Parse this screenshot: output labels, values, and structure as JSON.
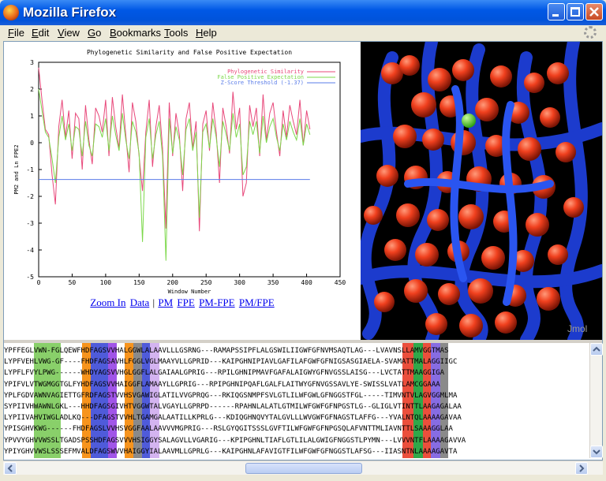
{
  "window": {
    "title": "Mozilla Firefox",
    "icon": "firefox-icon"
  },
  "menu": [
    {
      "label": "File",
      "accel": "F"
    },
    {
      "label": "Edit",
      "accel": "E"
    },
    {
      "label": "View",
      "accel": "V"
    },
    {
      "label": "Go",
      "accel": "G"
    },
    {
      "label": "Bookmarks",
      "accel": "B"
    },
    {
      "label": "Tools",
      "accel": "T"
    },
    {
      "label": "Help",
      "accel": "H"
    }
  ],
  "chart_data": {
    "type": "line",
    "title": "Phylogenetic Similarity and False Positive Expectation",
    "xlabel": "Window Number",
    "ylabel": "PM2 and Ln FPE2",
    "xlim": [
      0,
      450
    ],
    "ylim": [
      -5,
      3
    ],
    "xticks": [
      0,
      50,
      100,
      150,
      200,
      250,
      300,
      350,
      400,
      450
    ],
    "yticks": [
      3,
      2,
      1,
      0,
      -1,
      -2,
      -3,
      -4,
      -5
    ],
    "legend_position": "top-right",
    "series": [
      {
        "name": "Phylogenetic Similarity",
        "color": "#E8487A",
        "x": [
          0,
          5,
          10,
          15,
          20,
          25,
          30,
          35,
          40,
          45,
          50,
          55,
          60,
          65,
          70,
          75,
          80,
          85,
          90,
          95,
          100,
          105,
          110,
          115,
          120,
          125,
          130,
          135,
          140,
          145,
          150,
          155,
          160,
          165,
          170,
          175,
          180,
          185,
          190,
          195,
          200,
          205,
          210,
          215,
          220,
          225,
          230,
          235,
          240,
          245,
          250,
          255,
          260,
          265,
          270,
          275,
          280,
          285,
          290,
          295,
          300,
          305,
          310,
          315,
          320,
          325,
          330,
          335,
          340,
          345,
          350,
          355,
          360,
          365,
          370,
          375,
          380,
          385,
          390,
          395,
          400,
          405
        ],
        "y": [
          2.8,
          1.6,
          0.5,
          0.3,
          -1.2,
          -2.3,
          0.6,
          1.6,
          0.2,
          1.2,
          -0.6,
          1.1,
          0.9,
          -1.0,
          1.4,
          0.1,
          -0.8,
          1.3,
          1.0,
          0.4,
          1.6,
          -0.5,
          1.7,
          0.6,
          -0.2,
          1.8,
          0.3,
          -1.1,
          1.5,
          0.8,
          -0.5,
          -1.8,
          0.4,
          1.6,
          -0.9,
          0.6,
          1.4,
          -0.2,
          -3.2,
          1.5,
          -0.5,
          1.1,
          0.3,
          -1.8,
          0.9,
          1.5,
          -0.2,
          0.8,
          -3.3,
          0.7,
          1.2,
          -0.3,
          1.5,
          0.4,
          -1.5,
          1.3,
          0.6,
          -0.4,
          1.9,
          0.5,
          1.3,
          -2.0,
          -1.5,
          1.4,
          0.6,
          1.3,
          -0.5,
          1.8,
          0.1,
          1.1,
          1.5,
          0.4,
          -0.5,
          1.2,
          0.2,
          1.4,
          0.8,
          0.3,
          1.6,
          -0.1,
          1.2,
          0.5
        ]
      },
      {
        "name": "False Positive Expectation",
        "color": "#7CD84A",
        "x": [
          0,
          5,
          10,
          15,
          20,
          25,
          30,
          35,
          40,
          45,
          50,
          55,
          60,
          65,
          70,
          75,
          80,
          85,
          90,
          95,
          100,
          105,
          110,
          115,
          120,
          125,
          130,
          135,
          140,
          145,
          150,
          155,
          160,
          165,
          170,
          175,
          180,
          185,
          190,
          195,
          200,
          205,
          210,
          215,
          220,
          225,
          230,
          235,
          240,
          245,
          250,
          255,
          260,
          265,
          270,
          275,
          280,
          285,
          290,
          295,
          300,
          305,
          310,
          315,
          320,
          325,
          330,
          335,
          340,
          345,
          350,
          355,
          360,
          365,
          370,
          375,
          380,
          385,
          390,
          395,
          400,
          405
        ],
        "y": [
          2.0,
          1.2,
          0.4,
          0.2,
          -0.6,
          -1.5,
          0.2,
          1.0,
          0.1,
          0.7,
          -0.3,
          0.6,
          0.5,
          -0.5,
          0.8,
          -0.1,
          -0.5,
          0.7,
          0.6,
          0.2,
          0.9,
          -0.3,
          1.0,
          0.3,
          -0.3,
          1.1,
          0.1,
          -0.6,
          0.8,
          0.4,
          -0.4,
          -3.7,
          0.2,
          0.9,
          -0.6,
          0.3,
          0.8,
          -0.5,
          -4.4,
          0.9,
          -0.4,
          0.6,
          0.1,
          -1.2,
          0.5,
          0.9,
          -0.3,
          0.4,
          -2.8,
          0.4,
          0.7,
          -0.2,
          0.9,
          0.2,
          -0.9,
          0.8,
          0.3,
          -0.3,
          1.1,
          0.2,
          0.7,
          -1.2,
          -0.9,
          0.8,
          0.3,
          0.8,
          -0.4,
          1.0,
          0.0,
          0.6,
          0.9,
          0.2,
          -0.3,
          0.7,
          0.1,
          0.8,
          0.4,
          0.1,
          0.9,
          -0.1,
          0.7,
          0.3
        ]
      },
      {
        "name": "Z-Score Threshold (-1.37)",
        "color": "#5A7CE8",
        "x": [
          0,
          405
        ],
        "y": [
          -1.37,
          -1.37
        ]
      }
    ]
  },
  "links": [
    {
      "label": "Zoom In",
      "type": "link"
    },
    {
      "label": "Data",
      "type": "link"
    },
    {
      "label": "|",
      "type": "sep"
    },
    {
      "label": "PM",
      "type": "link"
    },
    {
      "label": "FPE",
      "type": "link"
    },
    {
      "label": "PM-FPE",
      "type": "link"
    },
    {
      "label": "PM/FPE",
      "type": "link"
    }
  ],
  "jmol": {
    "label": "Jmol"
  },
  "alignment": [
    "YPFFEGLVWN-FGLQEWFHDFAGSVVHALGGWLALAAVLLLGSRNG---RAMAPSSIPFLALGSWILIIGWFGFNVMSAQTLAG---LVAVNSLLAMVGGTMAS",
    "LYPFVEHLVWG-GF----FHDFAGSAVHLFGGLVGLMAAYVLLGPRID---KAIPGHNIPIAVLGAFILAFGWFGFNIGSASGIAELA-SVAMATTMALAGGIIGC",
    "LYPFLFVYLPWG------WHDYAGSVVHGLGGFLALGAIAALGPRIG---RPILGHNIPMAVFGAFALAIGWYGFNVGSSLAISG---LVCTATTMAAGGIGA",
    "YPIFVLVTWGMGGTGLFYHDFAGSVVHAIGGFLAMAAYLLGPRIG---RPIPGHNIPQAFLGALFLAITWYGFNVGSSAVLYE-SWISSLVATLAMCGGAAA",
    "YPLFGDVAWNVAGIETTGFRDFAGSTVVHSVGAWIGLATILVVGPRQG---RKIQGSNMPFSVLGTLILWFGWLGFNGGSTFGL-----TIMVNTVLAGVGGMLMA",
    "SYPIIVHWAWNLGKL---HHDFAGSGIVHTVGGWTALVGAYLLGPRPD------RPAHNLALATLGTMILWFGWFGFNPGSTLG--GLIGLVTINTTLAAGAGALAA",
    "LYPIIVAHVIWGLADLKQ---DFAGSTVVHLTGAMGALAATILLKPRLG---KDIQGHNQVYTALGVLLLWVGWFGFNAGSTLAFFG---YVALNTQLAAAAGAVAA",
    "YPISGHVKWG------FHDFAGSLVVHSVGGFAALAAVVVMGPRIG---RSLGYQGITSSSLGVFTILWFGWFGFNPGSQLAFVNTTMLIAVNTTLSAAAGGLAA",
    "YPVVYGHVVWSSLTGADSPSSHDFAGSVVVHSIGGYSALAGVLLVGARIG---KPIPGHNLTIAFLGTLILALGWIGFNGGSTLPYMN---LVVVNTFLAAAAGAVVA",
    "YPIYGHVVWSLSSSEFMVALDFAGSWVVHAIGGYIALAAVMLLGPRLG---KAIPGHNLAFAVIGTFILWFGWFGFNGGSTLAFSG---IIASNTNLAAAAGAVTA"
  ]
}
